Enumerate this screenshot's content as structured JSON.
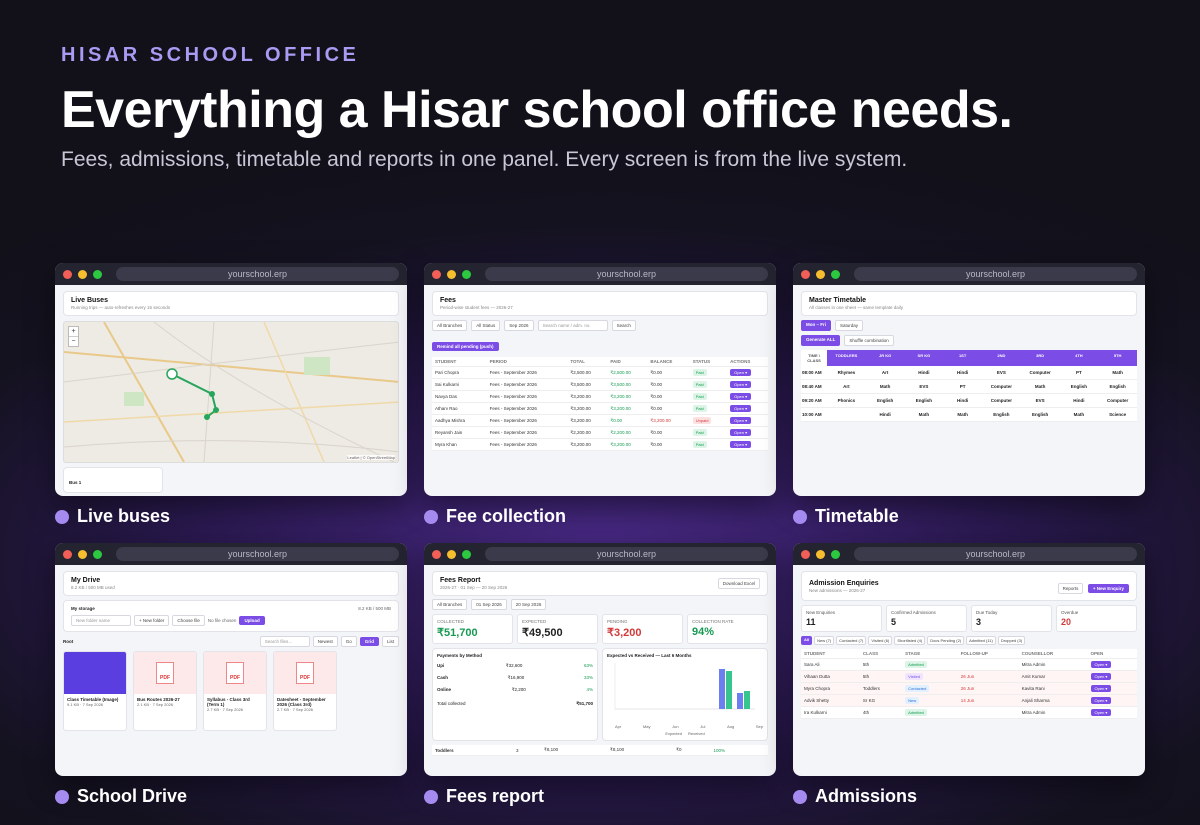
{
  "header": {
    "eyebrow": "HISAR SCHOOL OFFICE",
    "headline": "Everything a Hisar school office needs.",
    "subhead": "Fees, admissions, timetable and reports in one panel. Every screen is from the live system."
  },
  "browser_url": "yourschool.erp",
  "captions": {
    "live_buses": "Live buses",
    "fee_collection": "Fee collection",
    "timetable": "Timetable",
    "school_drive": "School Drive",
    "fees_report": "Fees report",
    "admissions": "Admissions"
  },
  "live_buses": {
    "title": "Live Buses",
    "subtitle": "Running trips — auto-refreshes every 15 seconds",
    "zoom_in": "+",
    "zoom_out": "−",
    "attribution": "Leaflet | © OpenStreetMap",
    "bus_label": "Bus 1"
  },
  "fees": {
    "title": "Fees",
    "subtitle": "Period-wise student fees — 2026-27",
    "filters": [
      "All Branches",
      "All Status",
      "Sep 2026"
    ],
    "search_placeholder": "Search name / adm. no.",
    "search_button": "Search",
    "remind_button": "Remind all pending (push)",
    "columns": [
      "STUDENT",
      "PERIOD",
      "TOTAL",
      "PAID",
      "BALANCE",
      "STATUS",
      "ACTIONS"
    ],
    "rows": [
      {
        "name": "Pari Chopra",
        "period": "Fees - September 2026",
        "total": "₹2,500.00",
        "paid": "₹2,500.00",
        "balance": "₹0.00",
        "status": "Paid"
      },
      {
        "name": "Sai Kulkarni",
        "period": "Fees - September 2026",
        "total": "₹3,500.00",
        "paid": "₹3,500.00",
        "balance": "₹0.00",
        "status": "Paid"
      },
      {
        "name": "Navya Das",
        "period": "Fees - September 2026",
        "total": "₹3,200.00",
        "paid": "₹3,200.00",
        "balance": "₹0.00",
        "status": "Paid"
      },
      {
        "name": "Atharv Rao",
        "period": "Fees - September 2026",
        "total": "₹3,200.00",
        "paid": "₹3,200.00",
        "balance": "₹0.00",
        "status": "Paid"
      },
      {
        "name": "Aadhya Mishra",
        "period": "Fees - September 2026",
        "total": "₹3,200.00",
        "paid": "₹0.00",
        "balance": "₹3,200.00",
        "status": "Unpaid"
      },
      {
        "name": "Reyansh Jain",
        "period": "Fees - September 2026",
        "total": "₹2,200.00",
        "paid": "₹2,200.00",
        "balance": "₹0.00",
        "status": "Paid"
      },
      {
        "name": "Myra Khan",
        "period": "Fees - September 2026",
        "total": "₹3,200.00",
        "paid": "₹3,200.00",
        "balance": "₹0.00",
        "status": "Paid"
      }
    ],
    "open_label": "Open ▾"
  },
  "timetable": {
    "title": "Master Timetable",
    "subtitle": "All classes in one sheet — same template daily",
    "day_tabs": [
      "Mon – Fri",
      "Saturday"
    ],
    "generate_button": "Generate ALL",
    "shuffle_button": "Shuffle combination",
    "headers": [
      "TIME \\ CLASS",
      "TODDLERS",
      "JR KG",
      "SR KG",
      "1ST",
      "2ND",
      "3RD",
      "4TH",
      "5TH"
    ],
    "rows": [
      {
        "time": "08:00 AM",
        "cells": [
          "Rhymes",
          "Art",
          "Hindi",
          "Hindi",
          "EVS",
          "Computer",
          "PT",
          "Math"
        ]
      },
      {
        "time": "08:40 AM",
        "cells": [
          "Art",
          "Math",
          "EVS",
          "PT",
          "Computer",
          "Math",
          "English",
          "English"
        ]
      },
      {
        "time": "09:20 AM",
        "cells": [
          "Phonics",
          "English",
          "English",
          "Hindi",
          "Computer",
          "EVS",
          "Hindi",
          "Computer"
        ]
      },
      {
        "time": "10:00 AM",
        "cells": [
          "",
          "Hindi",
          "Math",
          "Math",
          "English",
          "English",
          "Math",
          "Science"
        ]
      }
    ]
  },
  "drive": {
    "title": "My Drive",
    "subtitle": "8.2 KB / 500 MB used",
    "storage_label": "My storage",
    "storage_value": "8.2 KB / 500 MB",
    "folder_placeholder": "New folder name",
    "new_folder": "+ New folder",
    "choose_file": "Choose file",
    "no_file": "No file chosen",
    "upload": "Upload",
    "root_label": "Root",
    "search_placeholder": "Search files...",
    "sort": "Newest",
    "go": "Go",
    "grid": "Grid",
    "list": "List",
    "files": [
      {
        "name": "Class Timetable (Image)",
        "meta": "9.1 KB · 7 Sep 2026"
      },
      {
        "name": "Bus Routes 2026-27",
        "meta": "2.1 KB · 7 Sep 2026"
      },
      {
        "name": "Syllabus - Class 3rd (Term 1)",
        "meta": "2.7 KB · 7 Sep 2026"
      },
      {
        "name": "Datesheet - September 2026 (Class 3rd)",
        "meta": "2.7 KB · 7 Sep 2026"
      }
    ]
  },
  "fees_report": {
    "title": "Fees Report",
    "subtitle": "2026-27 · 01 Sep — 20 Sep 2026",
    "download": "Download Excel",
    "branch": "All Branches",
    "from_date": "01 Sep 2026",
    "to_date": "20 Sep 2026",
    "stats": [
      {
        "label": "COLLECTED",
        "value": "₹51,700"
      },
      {
        "label": "EXPECTED",
        "value": "₹49,500"
      },
      {
        "label": "PENDING",
        "value": "₹3,200"
      },
      {
        "label": "COLLECTION RATE",
        "value": "94%"
      }
    ],
    "payments_title": "Payments by Method",
    "methods": [
      {
        "name": "Upi",
        "amount": "₹32,600",
        "pct": "63%"
      },
      {
        "name": "Cash",
        "amount": "₹16,900",
        "pct": "33%"
      },
      {
        "name": "Online",
        "amount": "₹2,200",
        "pct": "4%"
      }
    ],
    "total_label": "Total collected",
    "total_value": "₹51,700",
    "chart_title": "Expected vs Received — Last 6 Months",
    "months": [
      "Apr",
      "May",
      "Jun",
      "Jul",
      "Aug",
      "Sep"
    ],
    "legend": [
      "Expected",
      "Received"
    ],
    "bottom_row": [
      "Toddlers",
      "3",
      "₹8,100",
      "₹8,100",
      "₹0",
      "100%"
    ]
  },
  "admissions": {
    "title": "Admission Enquiries",
    "subtitle": "New admissions — 2026-27",
    "reports_button": "Reports",
    "new_button": "+ New Enquiry",
    "stats": [
      {
        "label": "New Enquiries",
        "value": "11"
      },
      {
        "label": "Confirmed Admissions",
        "value": "5"
      },
      {
        "label": "Due Today",
        "value": "3"
      },
      {
        "label": "Overdue",
        "value": "20"
      }
    ],
    "tabs": [
      "All",
      "New (7)",
      "Contacted (7)",
      "Visited (6)",
      "Shortlisted (4)",
      "Docs Pending (2)",
      "Admitted (11)",
      "Dropped (3)"
    ],
    "columns": [
      "STUDENT",
      "CLASS",
      "STAGE",
      "FOLLOW-UP",
      "COUNSELLOR",
      "OPEN"
    ],
    "rows": [
      {
        "name": "Sara Ali",
        "class": "5th",
        "stage": "Admitted",
        "follow": "",
        "counsellor": "Mitra Admin"
      },
      {
        "name": "Vihaan Dutta",
        "class": "5th",
        "stage": "Visited",
        "follow": "26 Jun",
        "counsellor": "Amit Kumar"
      },
      {
        "name": "Myra Chopra",
        "class": "Toddlers",
        "stage": "Contacted",
        "follow": "26 Jun",
        "counsellor": "Kavita Rani"
      },
      {
        "name": "Advik Shetty",
        "class": "Sr KG",
        "stage": "New",
        "follow": "14 Jun",
        "counsellor": "Anjali Sharma"
      },
      {
        "name": "Ira Kulkarni",
        "class": "4th",
        "stage": "Admitted",
        "follow": "",
        "counsellor": "Mitra Admin"
      }
    ],
    "open_label": "Open ▾"
  }
}
